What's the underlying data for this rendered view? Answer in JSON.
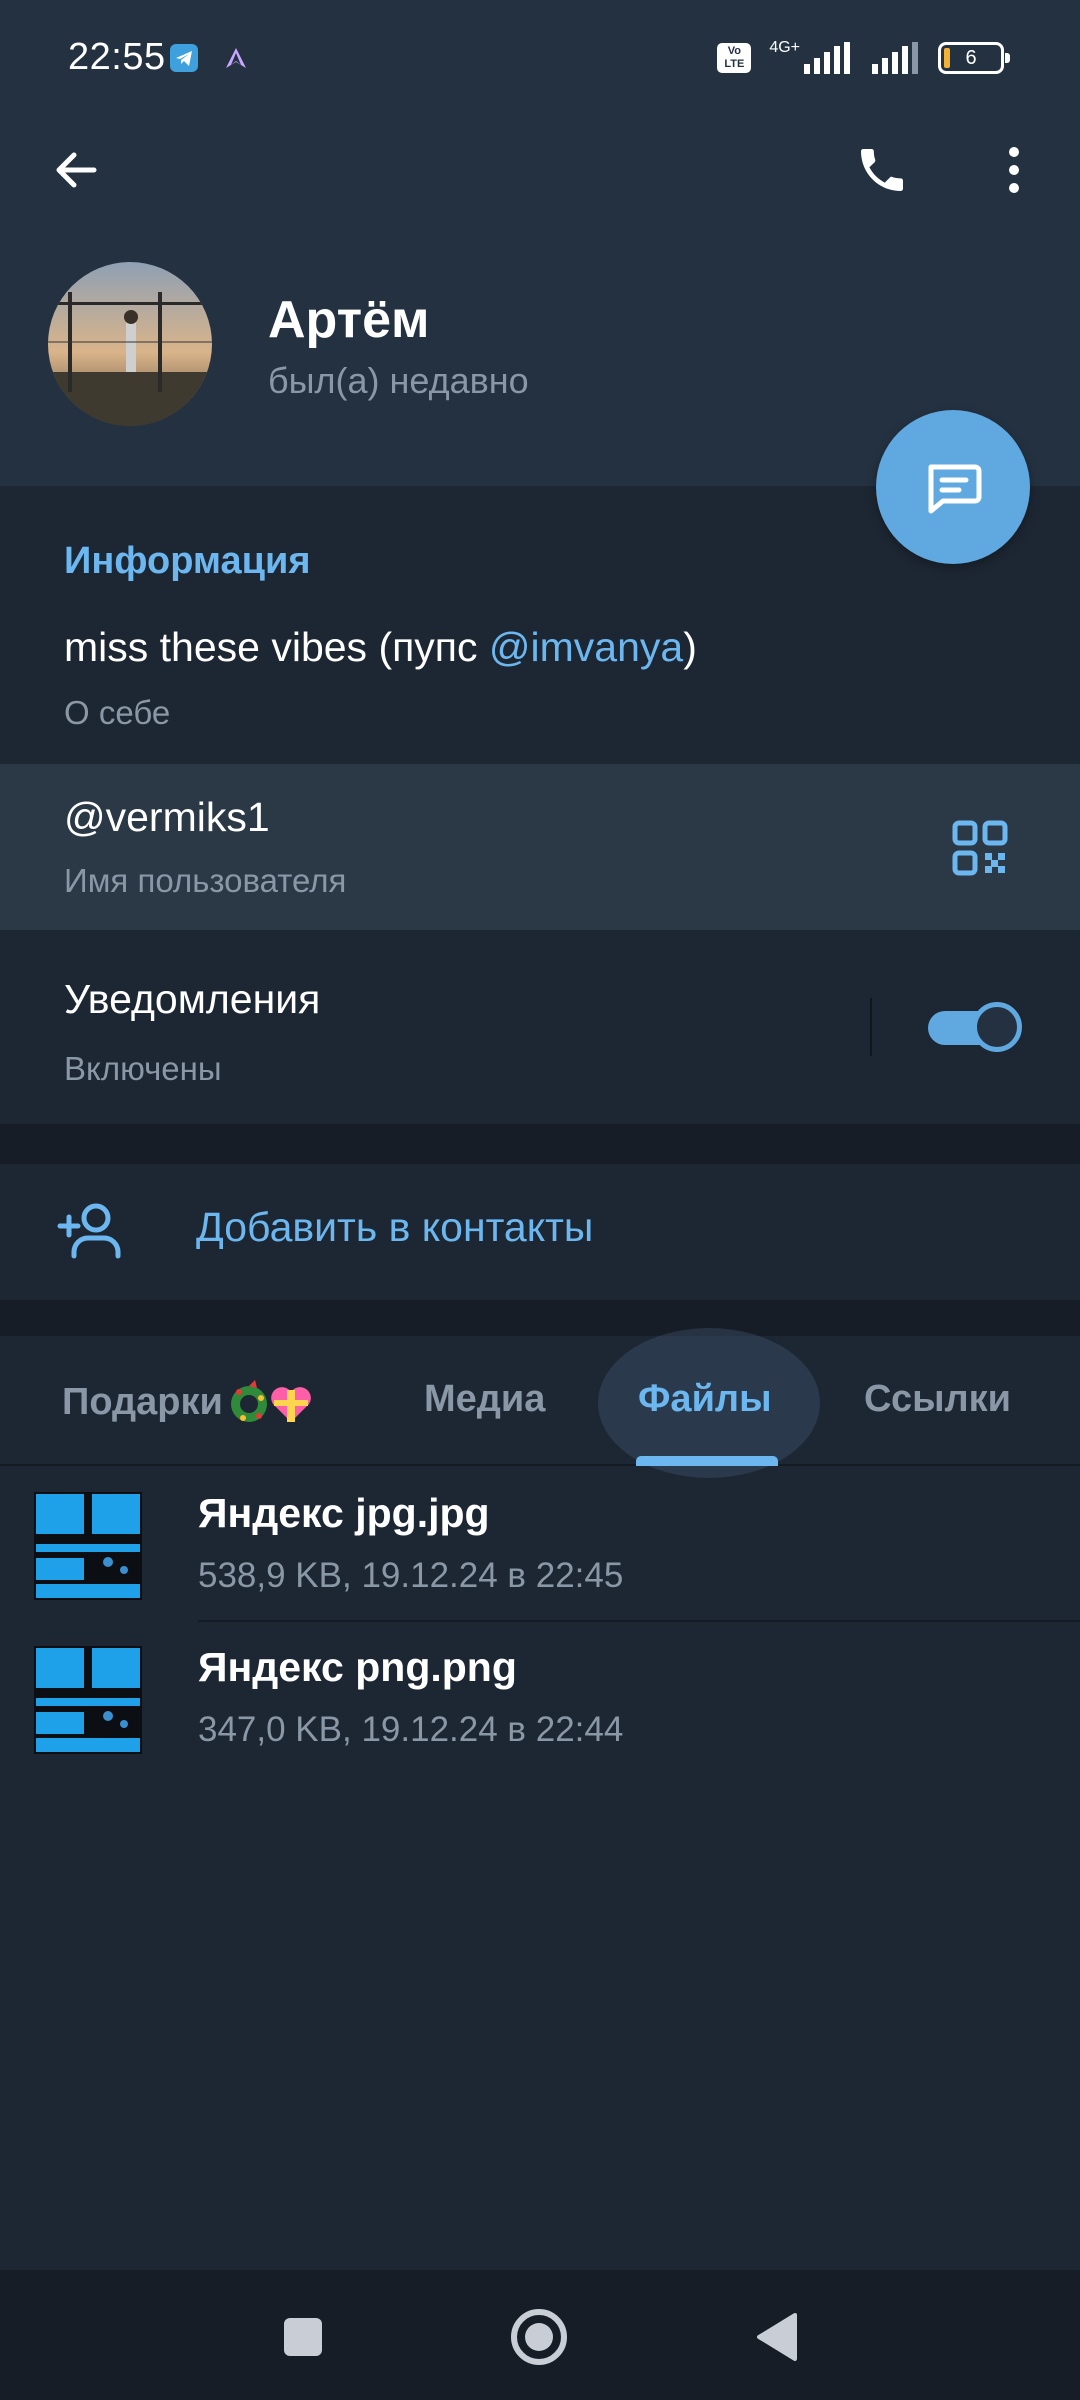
{
  "status_bar": {
    "time": "22:55",
    "network": "4G+",
    "volte": "Vo LTE",
    "battery": "6"
  },
  "header": {
    "back_icon": "arrow-left-icon",
    "call_icon": "phone-icon",
    "menu_icon": "more-vertical-icon",
    "name": "Артём",
    "last_seen": "был(а) недавно",
    "message_icon": "chat-bubble-icon"
  },
  "info": {
    "section_title": "Информация",
    "bio_prefix": "miss these vibes (пупс ",
    "bio_mention": "@imvanya",
    "bio_suffix": ")",
    "bio_label": "О себе",
    "username": "@vermiks1",
    "username_label": "Имя пользователя",
    "notifications_title": "Уведомления",
    "notifications_state": "Включены",
    "notifications_on": true
  },
  "actions": {
    "add_contact": "Добавить в контакты"
  },
  "tabs": [
    {
      "label": "Подарки",
      "active": false
    },
    {
      "label": "Медиа",
      "active": false
    },
    {
      "label": "Файлы",
      "active": true
    },
    {
      "label": "Ссылки",
      "active": false
    }
  ],
  "files": [
    {
      "name": "Яндекс jpg.jpg",
      "meta": "538,9 KB, 19.12.24 в 22:45"
    },
    {
      "name": "Яндекс png.png",
      "meta": "347,0 KB, 19.12.24 в 22:44"
    }
  ],
  "colors": {
    "accent": "#6cb7f0",
    "header_bg": "#243140",
    "page_bg": "#1d2733",
    "fab": "#5fa8e0"
  }
}
